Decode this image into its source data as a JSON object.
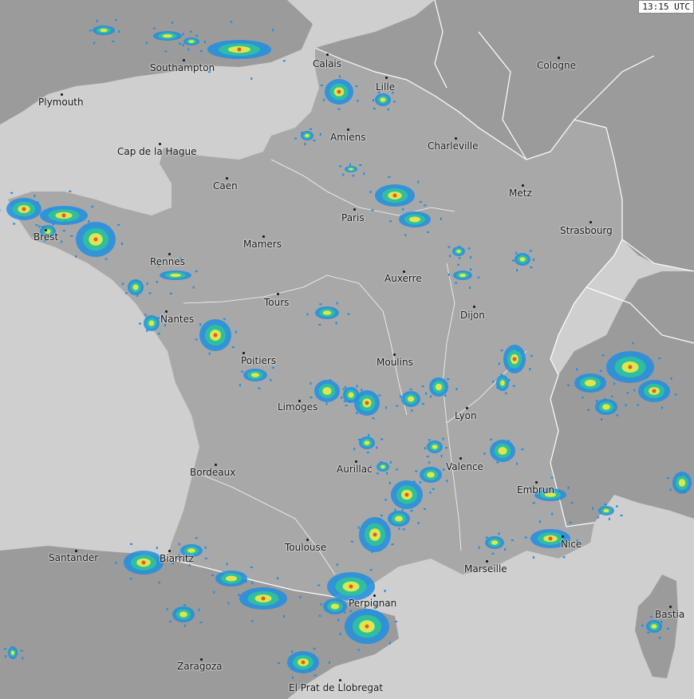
{
  "timestamp": "13:15 UTC",
  "colors": {
    "sea": "#cfcfcf",
    "france": "#a8a8a8",
    "neighbors": "#9b9b9b",
    "borders": "#ffffff",
    "radar_light": "#1e8ee0",
    "radar_mid": "#2fc49a",
    "radar_high": "#e8e84a",
    "radar_peak": "#e05a30"
  },
  "cities": [
    {
      "name": "Southampton",
      "key": "southampton"
    },
    {
      "name": "Plymouth",
      "key": "plymouth"
    },
    {
      "name": "Calais",
      "key": "calais"
    },
    {
      "name": "Lille",
      "key": "lille"
    },
    {
      "name": "Cologne",
      "key": "cologne"
    },
    {
      "name": "Amiens",
      "key": "amiens"
    },
    {
      "name": "Charleville",
      "key": "charleville"
    },
    {
      "name": "Cap de la Hague",
      "key": "cap-de-la-hague"
    },
    {
      "name": "Caen",
      "key": "caen"
    },
    {
      "name": "Metz",
      "key": "metz"
    },
    {
      "name": "Paris",
      "key": "paris"
    },
    {
      "name": "Brest",
      "key": "brest"
    },
    {
      "name": "Strasbourg",
      "key": "strasbourg"
    },
    {
      "name": "Mamers",
      "key": "mamers"
    },
    {
      "name": "Rennes",
      "key": "rennes"
    },
    {
      "name": "Auxerre",
      "key": "auxerre"
    },
    {
      "name": "Tours",
      "key": "tours"
    },
    {
      "name": "Dijon",
      "key": "dijon"
    },
    {
      "name": "Nantes",
      "key": "nantes"
    },
    {
      "name": "Poitiers",
      "key": "poitiers"
    },
    {
      "name": "Moulins",
      "key": "moulins"
    },
    {
      "name": "Limoges",
      "key": "limoges"
    },
    {
      "name": "Lyon",
      "key": "lyon"
    },
    {
      "name": "Valence",
      "key": "valence"
    },
    {
      "name": "Aurillac",
      "key": "aurillac"
    },
    {
      "name": "Bordeaux",
      "key": "bordeaux"
    },
    {
      "name": "Embrun",
      "key": "embrun"
    },
    {
      "name": "Toulouse",
      "key": "toulouse"
    },
    {
      "name": "Nice",
      "key": "nice"
    },
    {
      "name": "Santander",
      "key": "santander"
    },
    {
      "name": "Biarritz",
      "key": "biarritz"
    },
    {
      "name": "Marseille",
      "key": "marseille"
    },
    {
      "name": "Perpignan",
      "key": "perpignan"
    },
    {
      "name": "Bastia",
      "key": "bastia"
    },
    {
      "name": "Zaragoza",
      "key": "zaragoza"
    },
    {
      "name": "El Prat de Llobregat",
      "key": "el-prat-de-llobregat"
    }
  ]
}
